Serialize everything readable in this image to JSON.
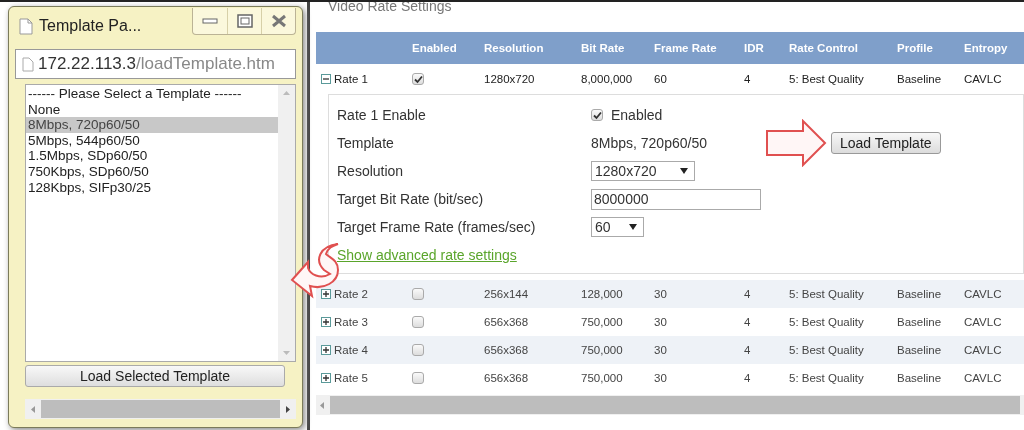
{
  "popup": {
    "title": "Template Pa...",
    "address_host": "172.22.113.3",
    "address_path": "/loadTemplate.htm",
    "options": [
      {
        "label": "------ Please Select a Template ------",
        "selected": false
      },
      {
        "label": "None",
        "selected": false
      },
      {
        "label": "8Mbps, 720p60/50",
        "selected": true
      },
      {
        "label": "5Mbps, 544p60/50",
        "selected": false
      },
      {
        "label": "1.5Mbps, SDp60/50",
        "selected": false
      },
      {
        "label": "750Kbps, SDp60/50",
        "selected": false
      },
      {
        "label": "128Kbps, SIFp30/25",
        "selected": false
      }
    ],
    "button": "Load Selected Template"
  },
  "main": {
    "heading": "Video Rate Settings",
    "columns": [
      "Enabled",
      "Resolution",
      "Bit Rate",
      "Frame Rate",
      "IDR",
      "Rate Control",
      "Profile",
      "Entropy"
    ],
    "rows": [
      {
        "name": "Rate 1",
        "expanded": true,
        "enabled": true,
        "cells": [
          "",
          "1280x720",
          "8,000,000",
          "60",
          "4",
          "5: Best Quality",
          "Baseline",
          "CAVLC"
        ]
      },
      {
        "name": "Rate 2",
        "expanded": false,
        "enabled": false,
        "cells": [
          "",
          "256x144",
          "128,000",
          "30",
          "4",
          "5: Best Quality",
          "Baseline",
          "CAVLC"
        ]
      },
      {
        "name": "Rate 3",
        "expanded": false,
        "enabled": false,
        "cells": [
          "",
          "656x368",
          "750,000",
          "30",
          "4",
          "5: Best Quality",
          "Baseline",
          "CAVLC"
        ]
      },
      {
        "name": "Rate 4",
        "expanded": false,
        "enabled": false,
        "cells": [
          "",
          "656x368",
          "750,000",
          "30",
          "4",
          "5: Best Quality",
          "Baseline",
          "CAVLC"
        ]
      },
      {
        "name": "Rate 5",
        "expanded": false,
        "enabled": false,
        "cells": [
          "",
          "656x368",
          "750,000",
          "30",
          "4",
          "5: Best Quality",
          "Baseline",
          "CAVLC"
        ]
      }
    ],
    "detail": {
      "enable_label": "Rate 1 Enable",
      "enable_checked": true,
      "enable_text": "Enabled",
      "template_label": "Template",
      "template_value": "8Mbps, 720p60/50",
      "load_button": "Load Template",
      "resolution_label": "Resolution",
      "resolution_value": "1280x720",
      "bit_rate_label": "Target Bit Rate (bit/sec)",
      "bit_rate_value": "8000000",
      "frame_rate_label": "Target Frame Rate (frames/sec)",
      "frame_rate_value": "60",
      "advanced_link": "Show advanced rate settings"
    }
  }
}
